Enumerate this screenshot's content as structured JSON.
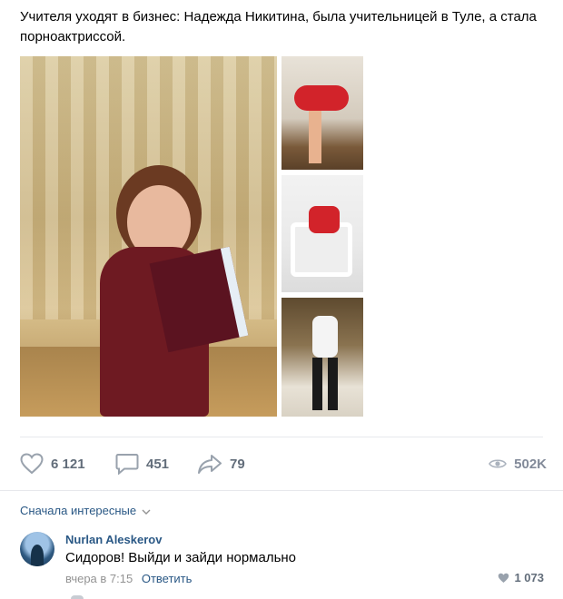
{
  "post": {
    "text": "Учителя уходят в бизнес: Надежда Никитина, была учительницей в Туле, а стала порноактриссой."
  },
  "actions": {
    "likes": "6 121",
    "comments": "451",
    "shares": "79",
    "views": "502K"
  },
  "comments_section": {
    "sort_label": "Сначала интересные"
  },
  "comment": {
    "author": "Nurlan Aleskerov",
    "text": "Сидоров! Выйди и зайди нормально",
    "time": "вчера в 7:15",
    "reply_label": "Ответить",
    "likes": "1 073"
  },
  "icons": {
    "like": "heart-icon",
    "comment": "comment-bubble-icon",
    "share": "share-arrow-icon",
    "views": "eye-icon",
    "sort": "chevron-down-icon"
  },
  "colors": {
    "link": "#2a5885",
    "muted": "#939393",
    "icon": "#99a2ad"
  }
}
